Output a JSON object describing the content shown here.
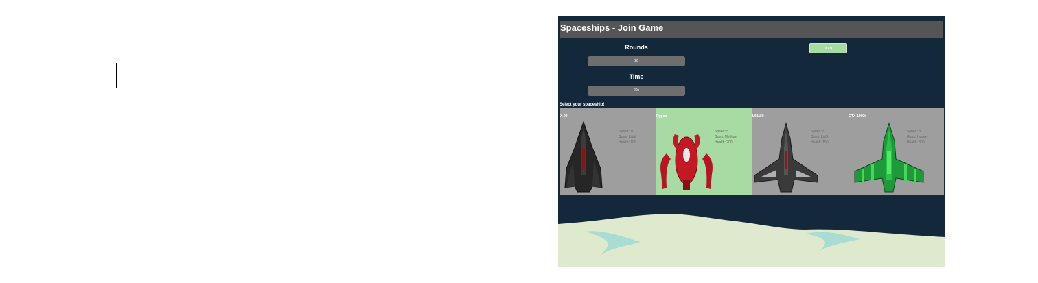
{
  "app": {
    "title": "Spaceships - Join Game",
    "rounds_label": "Rounds",
    "rounds_value": "20",
    "time_label": "Time",
    "time_value": "20s",
    "join_label": "JOIN",
    "select_prompt": "Select your spaceship!"
  },
  "ships": [
    {
      "name": "X-99",
      "speed": "Speed: 10",
      "guns": "Guns: Light",
      "health": "Health: 100",
      "color": "#2a2a2a",
      "accent": "#7a1a1a"
    },
    {
      "name": "Rypex",
      "speed": "Speed: 5",
      "guns": "Guns: Medium",
      "health": "Health: 200",
      "color": "#c21a24",
      "accent": "#f0f0f0"
    },
    {
      "name": "L61150",
      "speed": "Speed: 8",
      "guns": "Guns: Light",
      "health": "Health: 150",
      "color": "#3a3a3a",
      "accent": "#b0b0b0"
    },
    {
      "name": "GTX-1080ti",
      "speed": "Speed: 3",
      "guns": "Guns: Heavy",
      "health": "Health: 300",
      "color": "#1e9a3a",
      "accent": "#5cff6a"
    }
  ],
  "colors": {
    "background": "#13283a",
    "titlebar": "#555555",
    "field": "#6e6e6e",
    "join": "#a8dba3",
    "card": "#9e9e9e",
    "selected_card": "#a8dba3",
    "sand": "#dfe9cd",
    "water": "#a9dcd3"
  }
}
